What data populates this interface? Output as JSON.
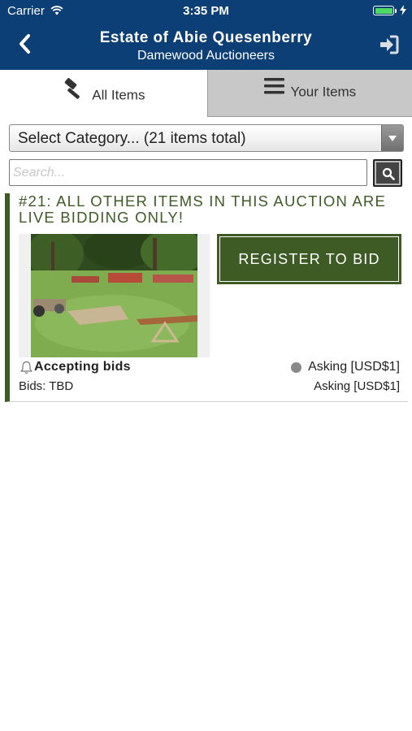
{
  "status_bar": {
    "carrier": "Carrier",
    "time": "3:35 PM"
  },
  "header": {
    "title": "Estate of Abie Quesenberry",
    "subtitle": "Damewood Auctioneers"
  },
  "tabs": [
    {
      "label": "All Items",
      "icon": "gavel-icon",
      "active": true
    },
    {
      "label": "Your Items",
      "icon": "hamburger-icon",
      "active": false
    }
  ],
  "category_select": {
    "selected": "Select Category... (21 items total)"
  },
  "search": {
    "placeholder": "Search...",
    "value": ""
  },
  "items": [
    {
      "title": "#21: ALL OTHER ITEMS IN THIS AUCTION ARE LIVE BIDDING ONLY!",
      "register_label": "REGISTER TO BID",
      "status": "Accepting bids",
      "asking_primary": "Asking [USD$1]",
      "bids": "Bids: TBD",
      "asking_secondary": "Asking [USD$1]"
    }
  ],
  "colors": {
    "header_bg": "#0c3f75",
    "accent_green": "#3e5b26",
    "inactive_tab": "#c8c8c8"
  }
}
